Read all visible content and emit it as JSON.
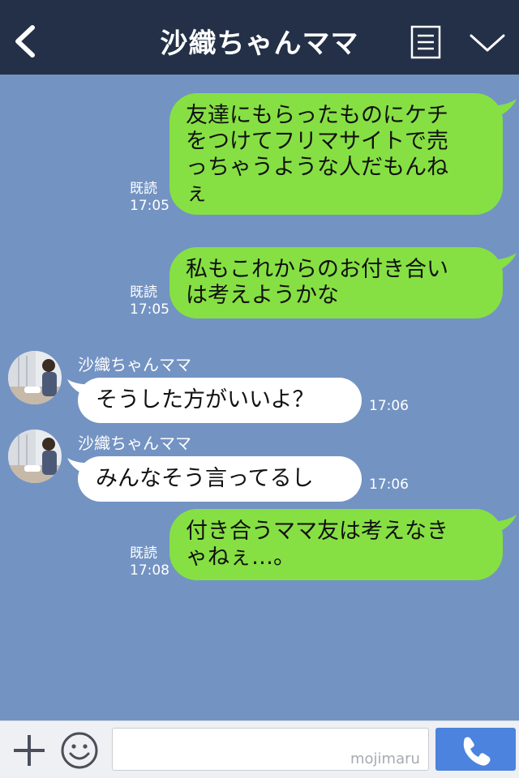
{
  "header": {
    "title": "沙織ちゃんママ",
    "back_icon": "chevron-left-icon",
    "notes_icon": "notes-icon",
    "dropdown_icon": "chevron-down-icon"
  },
  "messages": [
    {
      "from": "me",
      "lines": [
        "友達にもらったものにケチ",
        "をつけてフリマサイトで売",
        "っちゃうような人だもんね",
        "ぇ"
      ],
      "read": "既読",
      "time": "17:05"
    },
    {
      "from": "me",
      "lines": [
        "私もこれからのお付き合い",
        "は考えようかな"
      ],
      "read": "既読",
      "time": "17:05"
    },
    {
      "from": "them",
      "sender": "沙織ちゃんママ",
      "lines": [
        "そうした方がいいよ？"
      ],
      "time": "17:06"
    },
    {
      "from": "them",
      "sender": "沙織ちゃんママ",
      "lines": [
        "みんなそう言ってるし"
      ],
      "time": "17:06"
    },
    {
      "from": "me",
      "lines": [
        "付き合うママ友は考えなき",
        "ゃねぇ…。"
      ],
      "read": "既読",
      "time": "17:08"
    }
  ],
  "input_bar": {
    "plus_icon": "plus-icon",
    "emoji_icon": "smiley-icon",
    "input_value": "",
    "watermark": "mojimaru",
    "call_icon": "phone-icon"
  },
  "colors": {
    "header_bg": "#233047",
    "chat_bg": "#7393c3",
    "my_bubble": "#86e043",
    "their_bubble": "#ffffff",
    "call_button": "#4b83de"
  }
}
